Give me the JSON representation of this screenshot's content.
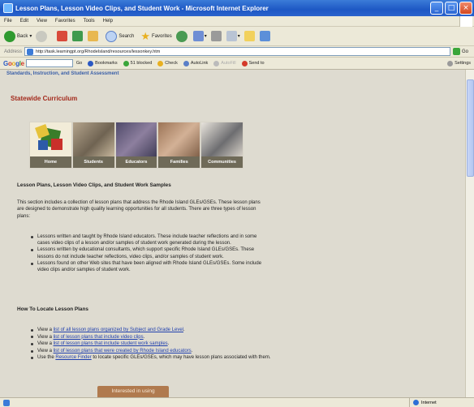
{
  "window": {
    "title": "Lesson Plans, Lesson Video Clips, and Student Work - Microsoft Internet Explorer",
    "min": "_",
    "max": "□",
    "close": "×"
  },
  "menu": [
    "File",
    "Edit",
    "View",
    "Favorites",
    "Tools",
    "Help"
  ],
  "toolbar": {
    "back": "Back",
    "search": "Search",
    "favorites": "Favorites"
  },
  "address": {
    "label": "Address",
    "url": "http://task.learningpt.org/RhodeIsland/resources/lessonkey.htm",
    "go": "Go"
  },
  "google_bar": {
    "logo": "Google",
    "go": "Go",
    "bookmarks": "Bookmarks",
    "blocked": "51 blocked",
    "check": "Check",
    "autolink": "AutoLink",
    "autofill": "AutoFill",
    "sendto": "Send to",
    "settings": "Settings"
  },
  "page": {
    "header_link": "Standards, Instruction, and Student Assessment",
    "section_title": "Statewide Curriculum",
    "nav": [
      "Home",
      "Students",
      "Educators",
      "Families",
      "Communities"
    ],
    "heading": "Lesson Plans, Lesson Video Clips, and Student Work Samples",
    "intro": "This section includes a collection of lesson plans that address the Rhode Island GLEs/GSEs. These lesson plans are designed to demonstrate high quality learning opportunities for all students. There are three types of lesson plans:",
    "types": [
      "Lessons written and taught by Rhode Island educators. These include teacher reflections and in some cases video clips of a lesson and/or samples of student work generated during the lesson.",
      "Lessons written by educational consultants, which support specific Rhode Island GLEs/GSEs. These lessons do not include teacher reflections, video clips, and/or samples of student work.",
      "Lessons found on other Web sites that have been aligned with Rhode Island GLEs/GSEs. Some include video clips and/or samples of student work."
    ],
    "locate_heading": "How To Locate Lesson Plans",
    "view_a": "View a",
    "locate_links": [
      "list of all lesson plans organized by Subject and Grade Level",
      "list of lesson plans that include video clips",
      "list of lesson plans that include student work samples",
      "list of lesson plans that were created by Rhode Island educators"
    ],
    "use_the": "Use the",
    "resource_finder": "Resource Finder",
    "resource_finder_rest": "to locate specific GLEs/GSEs, which may have lesson plans associated with them.",
    "interested": "Interested in using"
  },
  "status": {
    "zone": "Internet"
  }
}
